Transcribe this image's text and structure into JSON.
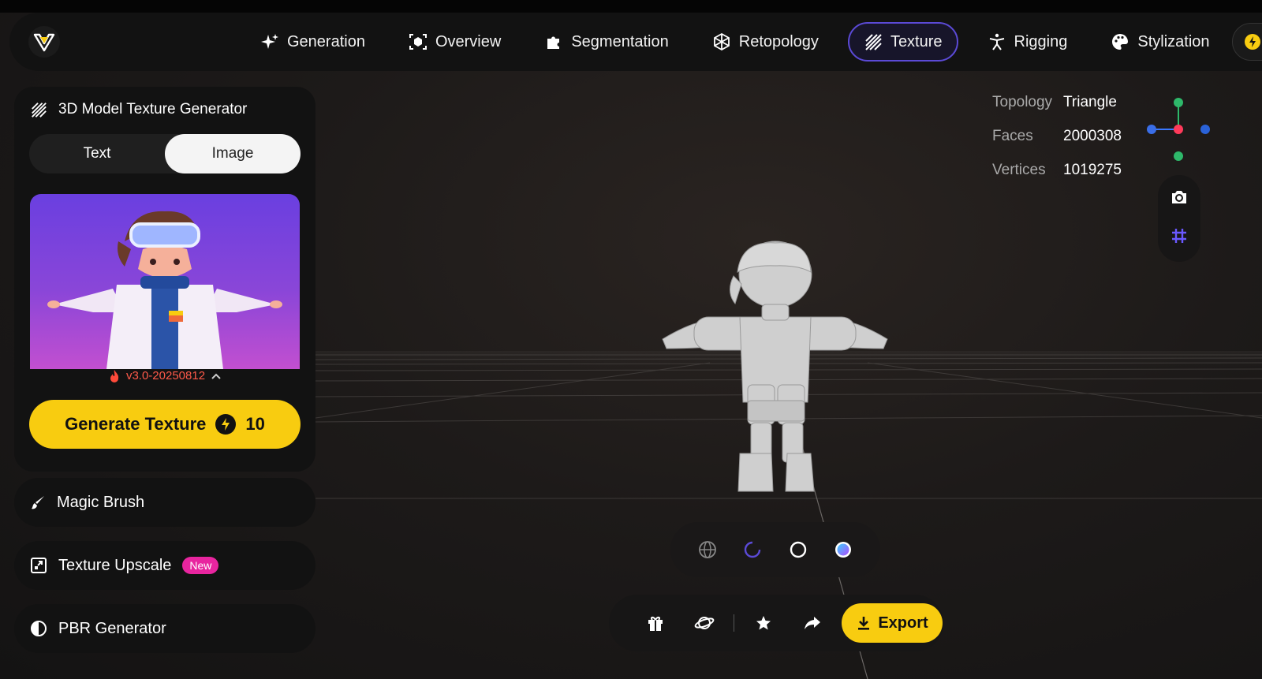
{
  "nav": {
    "items": [
      {
        "label": "Generation",
        "icon": "sparkle-icon"
      },
      {
        "label": "Overview",
        "icon": "cube-scan-icon"
      },
      {
        "label": "Segmentation",
        "icon": "puzzle-icon"
      },
      {
        "label": "Retopology",
        "icon": "mesh-cube-icon"
      },
      {
        "label": "Texture",
        "icon": "texture-hatch-icon",
        "active": true
      },
      {
        "label": "Rigging",
        "icon": "figure-icon"
      },
      {
        "label": "Stylization",
        "icon": "palette-icon"
      }
    ]
  },
  "panel": {
    "title": "3D Model Texture Generator",
    "tabs": {
      "text": "Text",
      "image": "Image",
      "selected": "Image"
    },
    "version": "v3.0-20250812",
    "generate_label": "Generate Texture",
    "generate_cost": "10"
  },
  "tools": {
    "magic_brush": "Magic Brush",
    "texture_upscale": "Texture Upscale",
    "new_badge": "New",
    "pbr_generator": "PBR Generator"
  },
  "stats": {
    "topology_label": "Topology",
    "topology_value": "Triangle",
    "faces_label": "Faces",
    "faces_value": "2000308",
    "vertices_label": "Vertices",
    "vertices_value": "1019275"
  },
  "actions": {
    "export_label": "Export"
  },
  "colors": {
    "accent_yellow": "#f8cc10",
    "active_border": "#5b4ad6",
    "new_badge": "#e8259f",
    "version_text": "#ff5a4a"
  }
}
